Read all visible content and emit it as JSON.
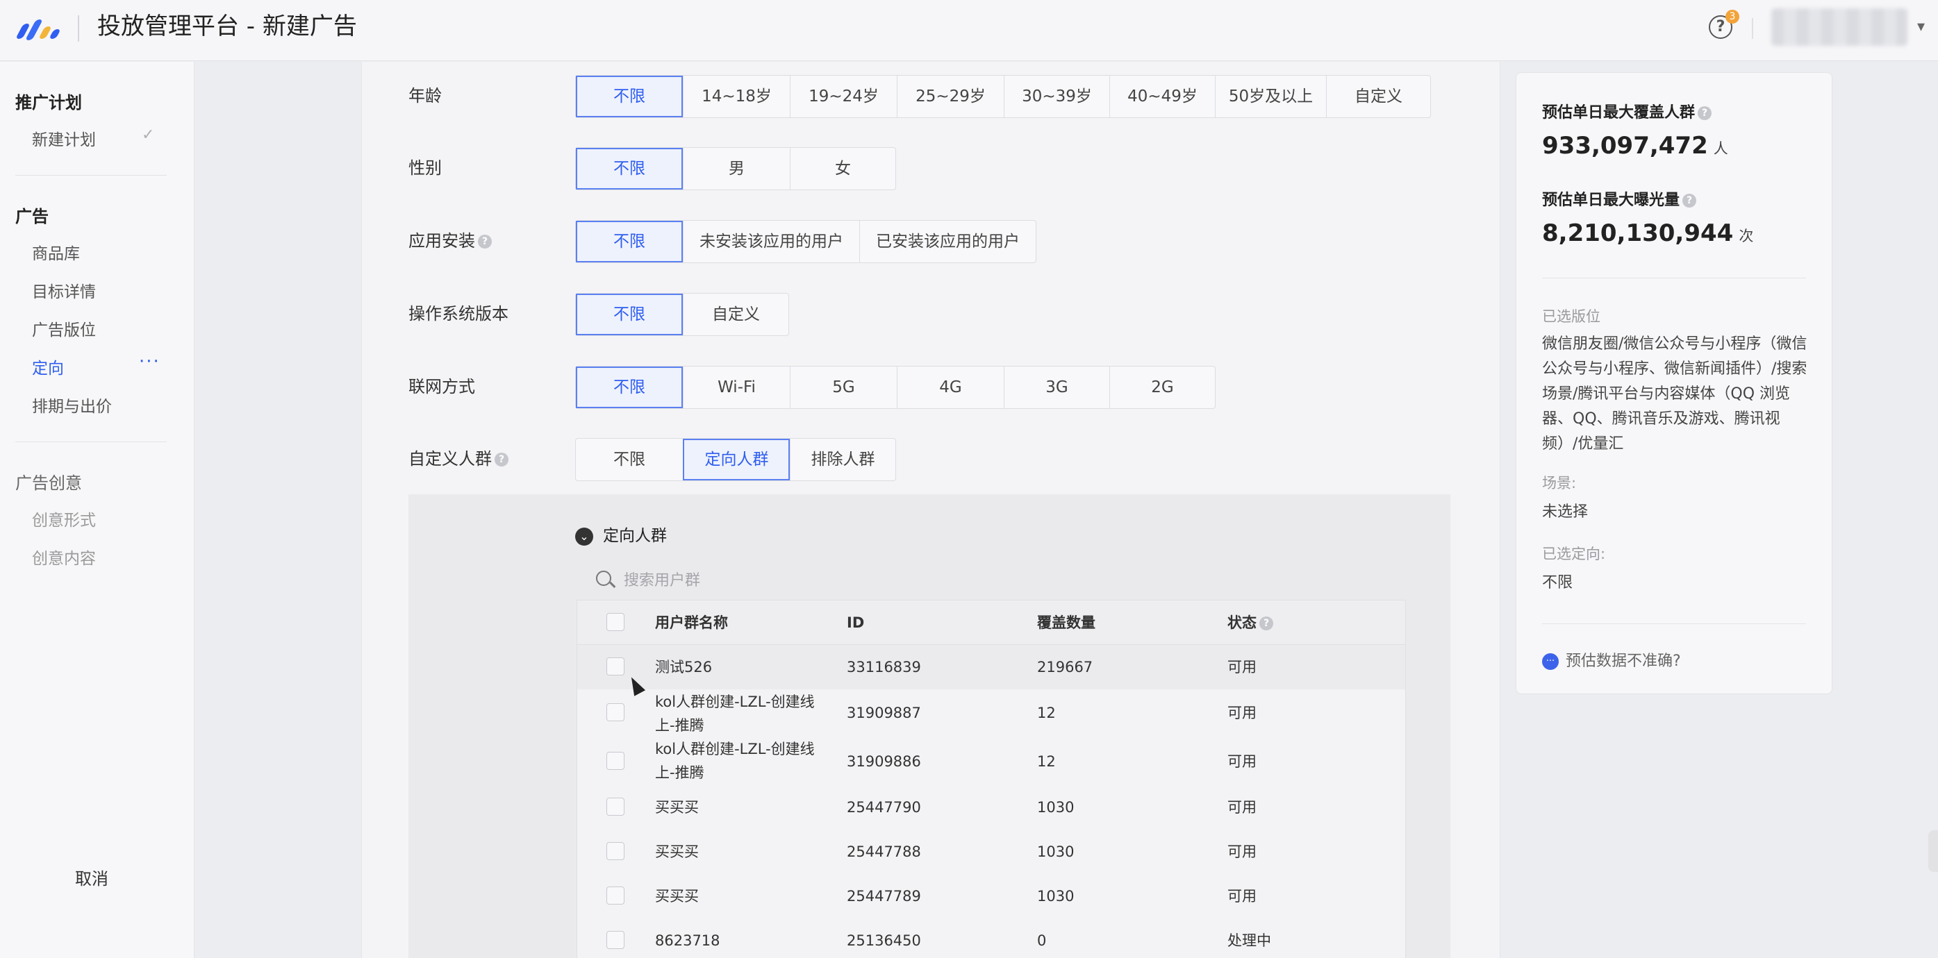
{
  "header": {
    "title": "投放管理平台 - 新建广告",
    "help_badge": "3"
  },
  "sidebar": {
    "group_plan": "推广计划",
    "plan_items": [
      {
        "label": "新建计划"
      }
    ],
    "group_ad": "广告",
    "ad_items": [
      {
        "label": "商品库"
      },
      {
        "label": "目标详情"
      },
      {
        "label": "广告版位"
      },
      {
        "label": "定向"
      },
      {
        "label": "排期与出价"
      }
    ],
    "group_creative": "广告创意",
    "creative_items": [
      {
        "label": "创意形式"
      },
      {
        "label": "创意内容"
      }
    ],
    "cancel_label": "取消",
    "more_label": "···",
    "check_glyph": "✓"
  },
  "form": {
    "age": {
      "label": "年龄",
      "options": [
        "不限",
        "14~18岁",
        "19~24岁",
        "25~29岁",
        "30~39岁",
        "40~49岁",
        "50岁及以上",
        "自定义"
      ]
    },
    "gender": {
      "label": "性别",
      "options": [
        "不限",
        "男",
        "女"
      ]
    },
    "app_install": {
      "label": "应用安装",
      "options": [
        "不限",
        "未安装该应用的用户",
        "已安装该应用的用户"
      ]
    },
    "os_version": {
      "label": "操作系统版本",
      "options": [
        "不限",
        "自定义"
      ]
    },
    "network": {
      "label": "联网方式",
      "options": [
        "不限",
        "Wi-Fi",
        "5G",
        "4G",
        "3G",
        "2G"
      ]
    },
    "custom_audience": {
      "label": "自定义人群",
      "options": [
        "不限",
        "定向人群",
        "排除人群"
      ]
    }
  },
  "audience": {
    "section_title": "定向人群",
    "search_placeholder": "搜索用户群",
    "columns": {
      "name": "用户群名称",
      "id": "ID",
      "coverage": "覆盖数量",
      "status": "状态"
    },
    "rows": [
      {
        "name1": "测试526",
        "name2": "",
        "id": "33116839",
        "coverage": "219667",
        "status": "可用"
      },
      {
        "name1": "kol人群创建-LZL-创建线",
        "name2": "上-推腾",
        "id": "31909887",
        "coverage": "12",
        "status": "可用"
      },
      {
        "name1": "kol人群创建-LZL-创建线",
        "name2": "上-推腾",
        "id": "31909886",
        "coverage": "12",
        "status": "可用"
      },
      {
        "name1": "买买买",
        "name2": "",
        "id": "25447790",
        "coverage": "1030",
        "status": "可用"
      },
      {
        "name1": "买买买",
        "name2": "",
        "id": "25447788",
        "coverage": "1030",
        "status": "可用"
      },
      {
        "name1": "买买买",
        "name2": "",
        "id": "25447789",
        "coverage": "1030",
        "status": "可用"
      },
      {
        "name1": "8623718",
        "name2": "",
        "id": "25136450",
        "coverage": "0",
        "status": "处理中"
      }
    ]
  },
  "summary": {
    "reach_title": "预估单日最大覆盖人群",
    "reach_value": "933,097,472",
    "reach_unit": "人",
    "exposure_title": "预估单日最大曝光量",
    "exposure_value": "8,210,130,944",
    "exposure_unit": "次",
    "placements_label": "已选版位",
    "placements_text": "微信朋友圈/微信公众号与小程序（微信公众号与小程序、微信新闻插件）/搜索场景/腾讯平台与内容媒体（QQ 浏览器、QQ、腾讯音乐及游戏、腾讯视频）/优量汇",
    "scene_label": "场景:",
    "scene_value": "未选择",
    "targeting_label": "已选定向:",
    "targeting_value": "不限",
    "feedback_text": "预估数据不准确?"
  },
  "colors": {
    "accent": "#2f5ef0",
    "selected_bg": "#eef2fd"
  }
}
